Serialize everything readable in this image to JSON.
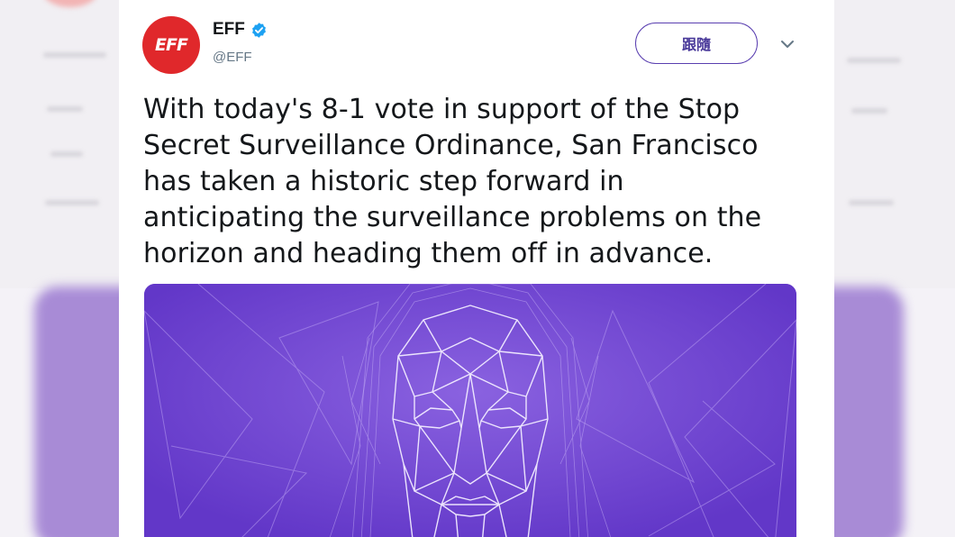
{
  "account": {
    "name": "EFF",
    "handle": "@EFF",
    "avatar_logo": "EFF",
    "verified": true
  },
  "follow_button": {
    "label": "跟隨"
  },
  "menu_icon": "chevron-down-icon",
  "tweet": {
    "lines": [
      "With today's 8-1 vote in support of the Stop",
      "Secret Surveillance Ordinance, San Francisco",
      "has taken a historic step forward in",
      "anticipating the surveillance problems on the",
      "horizon and heading them off in advance."
    ]
  },
  "media": {
    "description_icon": "wireframe-face-image",
    "background_color": "#6a3fcf"
  },
  "colors": {
    "brand_red": "#e0282b",
    "verified_blue": "#1da1f2",
    "follow_border": "#5a3fb0"
  }
}
